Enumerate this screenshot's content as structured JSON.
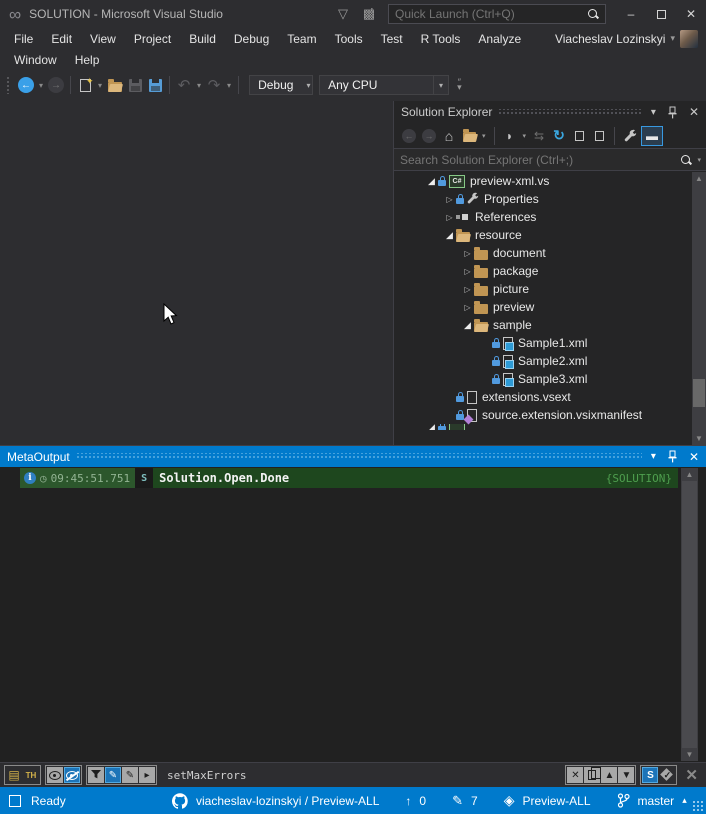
{
  "window_title": "SOLUTION - Microsoft Visual Studio",
  "title_bar": {
    "quick_launch_placeholder": "Quick Launch (Ctrl+Q)"
  },
  "menu": {
    "row1": [
      "File",
      "Edit",
      "View",
      "Project",
      "Build",
      "Debug",
      "Team",
      "Tools",
      "Test",
      "R Tools",
      "Analyze"
    ],
    "user_name": "Viacheslav Lozinskyi",
    "row2": [
      "Window",
      "Help"
    ]
  },
  "toolbar": {
    "configuration": "Debug",
    "platform": "Any CPU"
  },
  "solution_explorer": {
    "title": "Solution Explorer",
    "search_placeholder": "Search Solution Explorer (Ctrl+;)",
    "tree": [
      {
        "indent": 1,
        "arrow": "expanded",
        "lock": true,
        "icon": "csproj",
        "label": "preview-xml.vs"
      },
      {
        "indent": 2,
        "arrow": "collapsed",
        "lock": true,
        "icon": "wrench",
        "label": "Properties"
      },
      {
        "indent": 2,
        "arrow": "collapsed",
        "lock": false,
        "icon": "refs",
        "label": "References"
      },
      {
        "indent": 2,
        "arrow": "expanded",
        "lock": false,
        "icon": "folder-open",
        "label": "resource"
      },
      {
        "indent": 3,
        "arrow": "collapsed",
        "lock": false,
        "icon": "folder",
        "label": "document"
      },
      {
        "indent": 3,
        "arrow": "collapsed",
        "lock": false,
        "icon": "folder",
        "label": "package"
      },
      {
        "indent": 3,
        "arrow": "collapsed",
        "lock": false,
        "icon": "folder",
        "label": "picture"
      },
      {
        "indent": 3,
        "arrow": "collapsed",
        "lock": false,
        "icon": "folder",
        "label": "preview"
      },
      {
        "indent": 3,
        "arrow": "expanded",
        "lock": false,
        "icon": "folder-open",
        "label": "sample"
      },
      {
        "indent": 4,
        "arrow": null,
        "lock": true,
        "icon": "xml",
        "label": "Sample1.xml"
      },
      {
        "indent": 4,
        "arrow": null,
        "lock": true,
        "icon": "xml",
        "label": "Sample2.xml"
      },
      {
        "indent": 4,
        "arrow": null,
        "lock": true,
        "icon": "xml",
        "label": "Sample3.xml"
      },
      {
        "indent": 2,
        "arrow": null,
        "lock": true,
        "icon": "file",
        "label": "extensions.vsext"
      },
      {
        "indent": 2,
        "arrow": null,
        "lock": true,
        "icon": "manifest",
        "label": "source.extension.vsixmanifest"
      }
    ]
  },
  "output_panel": {
    "title": "MetaOutput",
    "log": {
      "timestamp": "09:45:51.751",
      "message": "Solution.Open.Done",
      "tag": "{SOLUTION}"
    },
    "filter_text": "setMaxErrors"
  },
  "status_bar": {
    "ready": "Ready",
    "repo": "viacheslav-lozinskyi / Preview-ALL",
    "incoming": "0",
    "changes": "7",
    "project": "Preview-ALL",
    "branch": "master"
  },
  "colors": {
    "accent_blue": "#007ACC",
    "titlebar_bg": "#2D2D30",
    "panel_bg": "#252526",
    "log_green_left": "#2C572C",
    "log_green_main": "#1E471E",
    "log_tag_green": "#4E9E4E",
    "folder_tan": "#C09553",
    "selected_border": "#3899E0"
  }
}
